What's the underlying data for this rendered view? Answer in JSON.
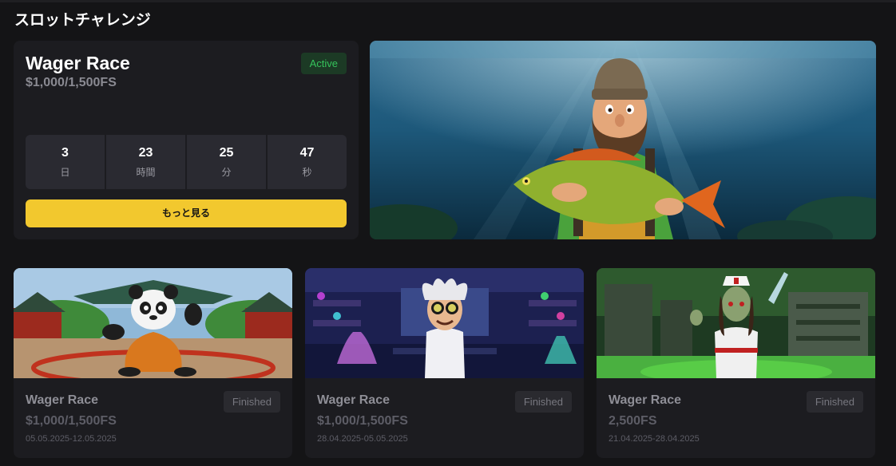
{
  "page": {
    "title": "スロットチャレンジ"
  },
  "featured": {
    "title": "Wager Race",
    "prize": "$1,000/1,500FS",
    "status": "Active",
    "countdown": [
      {
        "value": "3",
        "unit": "日"
      },
      {
        "value": "23",
        "unit": "時間"
      },
      {
        "value": "25",
        "unit": "分"
      },
      {
        "value": "47",
        "unit": "秒"
      }
    ],
    "more_label": "もっと見る"
  },
  "cards": [
    {
      "title": "Wager Race",
      "prize": "$1,000/1,500FS",
      "dates": "05.05.2025-12.05.2025",
      "status": "Finished"
    },
    {
      "title": "Wager Race",
      "prize": "$1,000/1,500FS",
      "dates": "28.04.2025-05.05.2025",
      "status": "Finished"
    },
    {
      "title": "Wager Race",
      "prize": "2,500FS",
      "dates": "21.04.2025-28.04.2025",
      "status": "Finished"
    }
  ],
  "colors": {
    "background": "#141416",
    "card": "#1c1c20",
    "accent": "#f2c82e",
    "active": "#35c35b"
  }
}
